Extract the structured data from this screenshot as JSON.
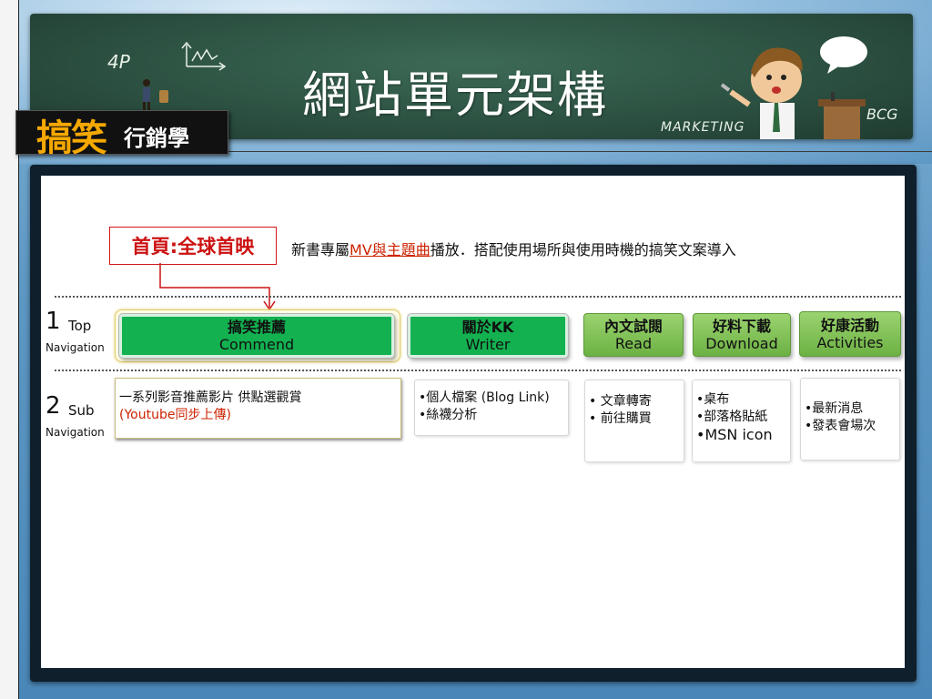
{
  "header": {
    "title": "網站單元架構",
    "chalk_4p": "4P",
    "chalk_marketing": "MARKETING",
    "chalk_bcg": "BCG",
    "logo_big": "搞笑",
    "logo_small": "行銷學"
  },
  "home": {
    "label": "首頁:全球首映",
    "desc_before": "新書專屬",
    "desc_highlight": "MV與主題曲",
    "desc_after": "播放．搭配使用場所與使用時機的搞笑文案導入"
  },
  "levels": {
    "top": {
      "num": "1",
      "name": "Top",
      "sub": "Navigation"
    },
    "sub": {
      "num": "2",
      "name": "Sub",
      "sub": "Navigation"
    }
  },
  "top_nav": [
    {
      "zh": "搞笑推薦",
      "en": "Commend"
    },
    {
      "zh": "關於KK",
      "en": "Writer"
    },
    {
      "zh": "內文試閱",
      "en": "Read"
    },
    {
      "zh": "好料下載",
      "en": "Download"
    },
    {
      "zh": "好康活動",
      "en": "Activities"
    }
  ],
  "sub_nav": {
    "commend": {
      "line1": "一系列影音推薦影片 供點選觀賞",
      "line2": "(Youtube同步上傳)"
    },
    "writer": [
      "•個人檔案 (Blog Link)",
      "•絲襪分析"
    ],
    "read": [
      "• 文章轉寄",
      "• 前往購買"
    ],
    "download": [
      "•桌布",
      "•部落格貼紙",
      "•MSN icon"
    ],
    "activities": [
      "•最新消息",
      "•發表會場次"
    ]
  },
  "colors": {
    "accent_red": "#cc1111",
    "nav_green": "#13b150",
    "nav_olive": "#7cbf4f"
  }
}
